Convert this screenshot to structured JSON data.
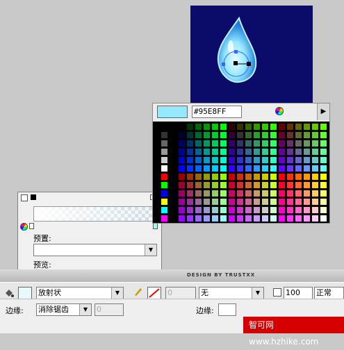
{
  "swatches": {
    "hex_value": "#95E8FF",
    "preview_color": "#95E8FF"
  },
  "gradient_panel": {
    "preset_label": "预置:",
    "preview_label": "预览:"
  },
  "credit": "DESIGN BY TRUSTXX",
  "properties": {
    "fill_type": "放射状",
    "stroke_style": "无",
    "alpha_value": "100",
    "blend_mode": "正常",
    "edge_label": "边缘:",
    "edge_value": "消除锯齿",
    "edge_num": "0",
    "stroke_num": "0",
    "edge_label2": "边缘:"
  },
  "watermark": "智可网 www.hzhike.com"
}
